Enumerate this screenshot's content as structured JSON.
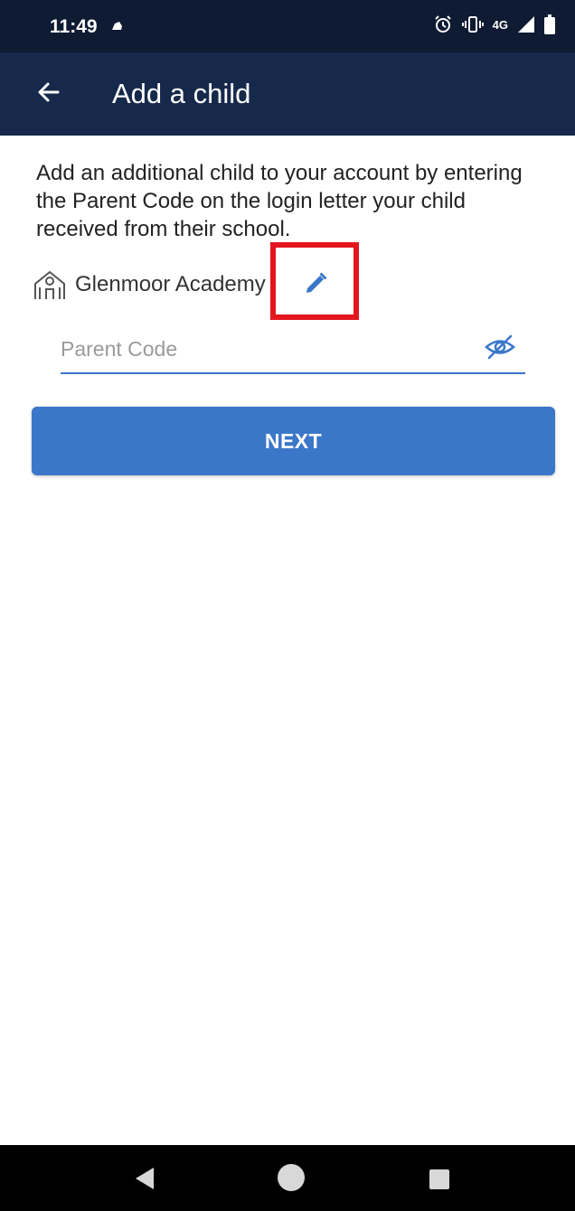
{
  "status_bar": {
    "time": "11:49",
    "network": "4G"
  },
  "app_bar": {
    "title": "Add a child"
  },
  "content": {
    "description": "Add an additional child to your account by entering the Parent Code on the login letter your child received from their school.",
    "school_name": "Glenmoor Academy",
    "parent_code_placeholder": "Parent Code",
    "parent_code_value": "",
    "next_label": "NEXT"
  },
  "colors": {
    "status_bar_bg": "#0e1b33",
    "app_bar_bg": "#17294b",
    "accent": "#3b77c8",
    "highlight": "#e3161e"
  },
  "icons": {
    "back": "arrow-left-icon",
    "school": "school-building-icon",
    "edit": "pencil-icon",
    "visibility": "eye-off-icon",
    "status": [
      "notification-icon",
      "alarm-icon",
      "vibrate-icon",
      "signal-icon",
      "battery-icon"
    ],
    "nav": [
      "nav-back-icon",
      "nav-home-icon",
      "nav-recents-icon"
    ]
  }
}
